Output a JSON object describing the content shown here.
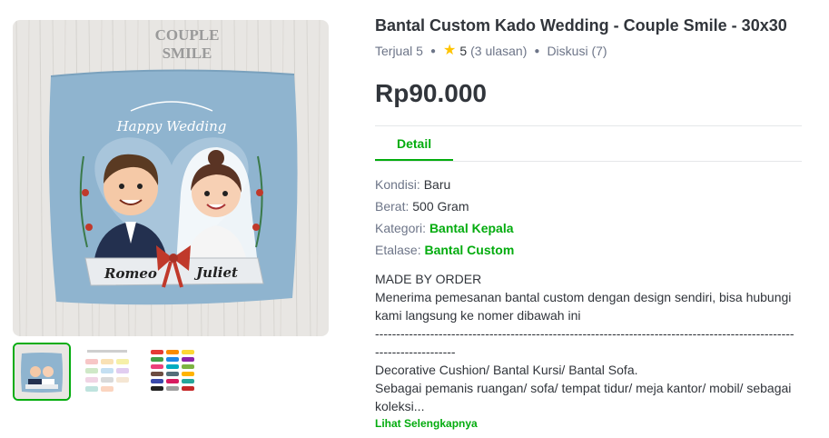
{
  "gallery": {
    "main_image": {
      "header_lines": [
        "COUPLE",
        "SMILE"
      ],
      "banner_text": "Happy Wedding",
      "name_left": "Romeo",
      "name_right": "Juliet"
    },
    "thumbnails": [
      {
        "alt": "couple-pillow",
        "active": true
      },
      {
        "alt": "pastel-color-chart",
        "active": false
      },
      {
        "alt": "color-chart",
        "active": false
      }
    ]
  },
  "product": {
    "title": "Bantal Custom Kado Wedding - Couple Smile - 30x30",
    "sold_label": "Terjual",
    "sold_count": "5",
    "rating": "5",
    "reviews": "(3 ulasan)",
    "discussion_label": "Diskusi",
    "discussion_count": "(7)",
    "price": "Rp90.000"
  },
  "tabs": [
    {
      "label": "Detail",
      "active": true
    }
  ],
  "specs": {
    "condition_key": "Kondisi: ",
    "condition_val": "Baru",
    "weight_key": "Berat: ",
    "weight_val": "500 Gram",
    "category_key": "Kategori: ",
    "category_val": "Bantal Kepala",
    "showcase_key": "Etalase: ",
    "showcase_val": "Bantal Custom"
  },
  "description": "MADE BY ORDER\nMenerima pemesanan bantal custom dengan design sendiri, bisa hubungi kami langsung ke nomer dibawah ini\n----------------------------------------------------------------------------------------------------------------------\nDecorative Cushion/ Bantal Kursi/ Bantal Sofa.\nSebagai pemanis ruangan/ sofa/ tempat tidur/ meja kantor/ mobil/ sebagai koleksi...",
  "read_more": "Lihat Selengkapnya",
  "colors": {
    "accent": "#03ac0e",
    "star": "#ffc400",
    "pillow": "#8fb4cf"
  }
}
